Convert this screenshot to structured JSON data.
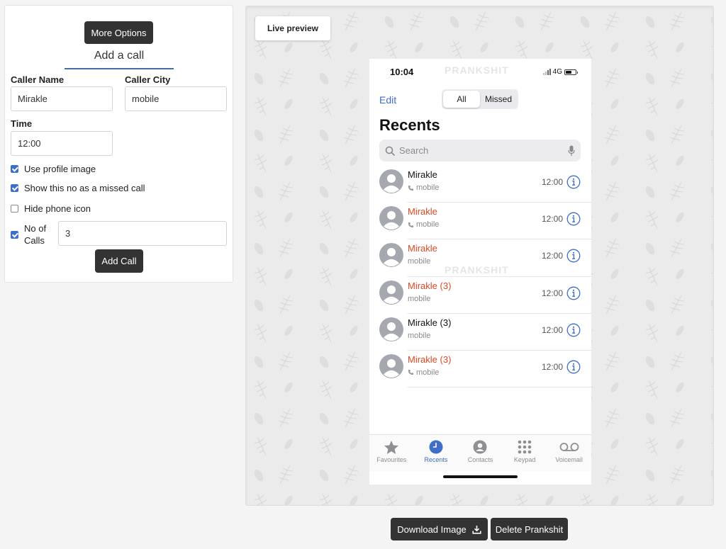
{
  "form": {
    "more_options_label": "More Options",
    "title": "Add a call",
    "caller_name_label": "Caller Name",
    "caller_name_value": "Mirakle",
    "caller_city_label": "Caller City",
    "caller_city_value": "mobile",
    "time_label": "Time",
    "time_value": "12:00",
    "checkboxes": [
      {
        "label": "Use profile image",
        "checked": true
      },
      {
        "label": "Show this no as a missed call",
        "checked": true
      },
      {
        "label": "Hide phone icon",
        "checked": false
      },
      {
        "label": "No of Calls",
        "checked": true
      }
    ],
    "no_of_calls_value": "3",
    "add_call_label": "Add Call"
  },
  "preview": {
    "tab_label": "Live preview",
    "watermark": "PRANKSHIT",
    "phone": {
      "status_time": "10:04",
      "network": "4G",
      "edit_label": "Edit",
      "segments": [
        "All",
        "Missed"
      ],
      "active_segment": "All",
      "title": "Recents",
      "search_placeholder": "Search",
      "calls": [
        {
          "name": "Mirakle",
          "sub": "mobile",
          "time": "12:00",
          "missed": false,
          "phone_icon": true
        },
        {
          "name": "Mirakle",
          "sub": "mobile",
          "time": "12:00",
          "missed": true,
          "phone_icon": true
        },
        {
          "name": "Mirakle",
          "sub": "mobile",
          "time": "12:00",
          "missed": true,
          "phone_icon": false
        },
        {
          "name": "Mirakle (3)",
          "sub": "mobile",
          "time": "12:00",
          "missed": true,
          "phone_icon": false
        },
        {
          "name": "Mirakle (3)",
          "sub": "mobile",
          "time": "12:00",
          "missed": false,
          "phone_icon": false
        },
        {
          "name": "Mirakle (3)",
          "sub": "mobile",
          "time": "12:00",
          "missed": true,
          "phone_icon": true
        }
      ],
      "tabs": [
        {
          "label": "Favourites",
          "icon": "star-icon",
          "active": false
        },
        {
          "label": "Recents",
          "icon": "clock-icon",
          "active": true
        },
        {
          "label": "Contacts",
          "icon": "person-circle-icon",
          "active": false
        },
        {
          "label": "Keypad",
          "icon": "keypad-icon",
          "active": false
        },
        {
          "label": "Voicemail",
          "icon": "voicemail-icon",
          "active": false
        }
      ]
    }
  },
  "actions": {
    "download_label": "Download Image",
    "delete_label": "Delete Prankshit"
  },
  "colors": {
    "accent": "#3e6ec8",
    "missed": "#d64a25",
    "button_dark": "#333333",
    "checkbox": "#3d6fca"
  }
}
